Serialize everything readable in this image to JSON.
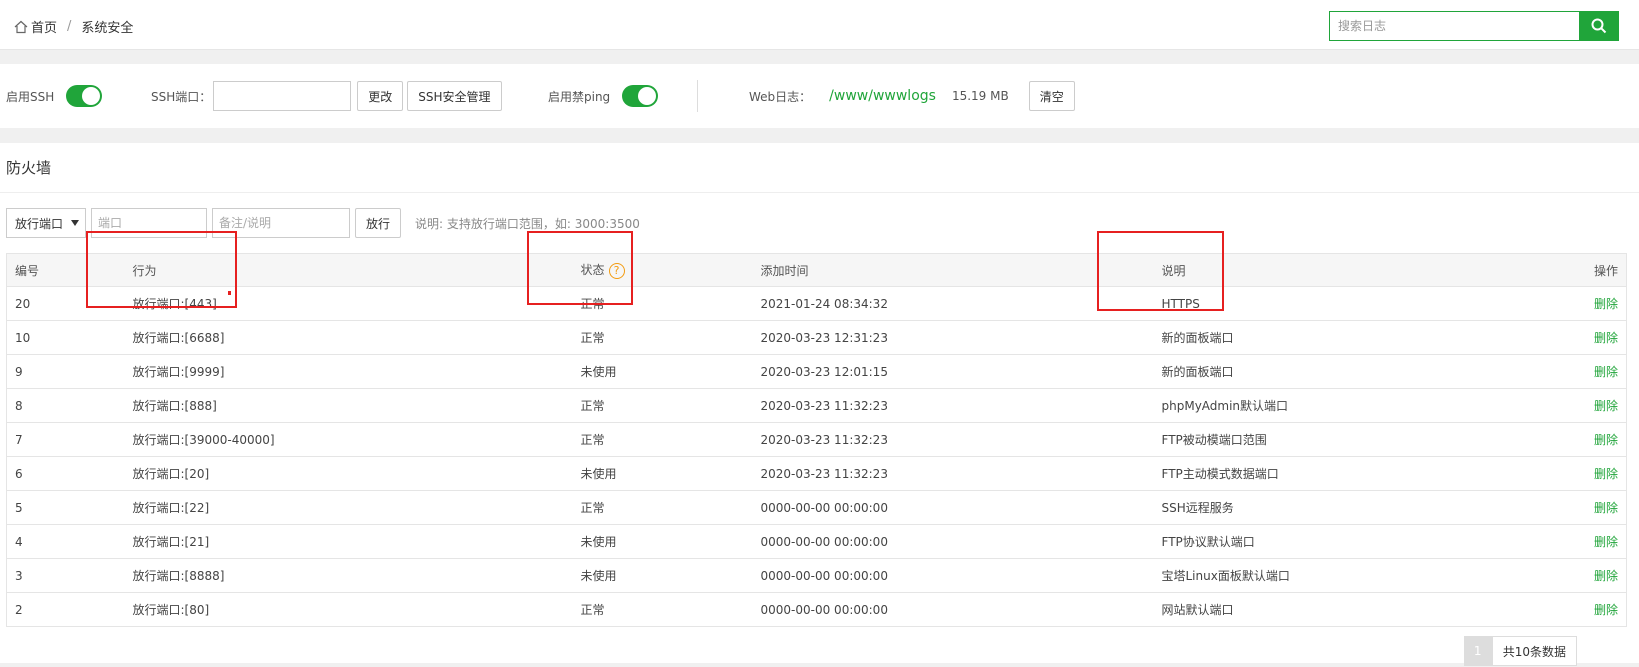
{
  "breadcrumb": {
    "home": "首页",
    "separator": "/",
    "current": "系统安全"
  },
  "search": {
    "placeholder": "搜索日志"
  },
  "settings": {
    "ssh_label": "启用SSH",
    "ssh_enabled": true,
    "ssh_port_label": "SSH端口：",
    "ssh_port_value": "",
    "change_btn": "更改",
    "ssh_manage_btn": "SSH安全管理",
    "ping_label": "启用禁ping",
    "ping_enabled": true,
    "web_log_label": "Web日志：",
    "web_log_path": "/www/wwwlogs",
    "web_log_size": "15.19 MB",
    "clear_btn": "清空"
  },
  "firewall": {
    "title": "防火墙",
    "select_value": "放行端口",
    "port_placeholder": "端口",
    "note_placeholder": "备注/说明",
    "allow_btn": "放行",
    "hint": "说明: 支持放行端口范围，如: 3000:3500",
    "columns": [
      "编号",
      "行为",
      "状态",
      "添加时间",
      "说明",
      "操作"
    ],
    "rows": [
      {
        "id": "20",
        "action": "放行端口:[443]",
        "status": "正常",
        "time": "2021-01-24 08:34:32",
        "desc": "HTTPS",
        "op": "删除"
      },
      {
        "id": "10",
        "action": "放行端口:[6688]",
        "status": "正常",
        "time": "2020-03-23 12:31:23",
        "desc": "新的面板端口",
        "op": "删除"
      },
      {
        "id": "9",
        "action": "放行端口:[9999]",
        "status": "未使用",
        "time": "2020-03-23 12:01:15",
        "desc": "新的面板端口",
        "op": "删除"
      },
      {
        "id": "8",
        "action": "放行端口:[888]",
        "status": "正常",
        "time": "2020-03-23 11:32:23",
        "desc": "phpMyAdmin默认端口",
        "op": "删除"
      },
      {
        "id": "7",
        "action": "放行端口:[39000-40000]",
        "status": "正常",
        "time": "2020-03-23 11:32:23",
        "desc": "FTP被动模端口范围",
        "op": "删除"
      },
      {
        "id": "6",
        "action": "放行端口:[20]",
        "status": "未使用",
        "time": "2020-03-23 11:32:23",
        "desc": "FTP主动模式数据端口",
        "op": "删除"
      },
      {
        "id": "5",
        "action": "放行端口:[22]",
        "status": "正常",
        "time": "0000-00-00 00:00:00",
        "desc": "SSH远程服务",
        "op": "删除"
      },
      {
        "id": "4",
        "action": "放行端口:[21]",
        "status": "未使用",
        "time": "0000-00-00 00:00:00",
        "desc": "FTP协议默认端口",
        "op": "删除"
      },
      {
        "id": "3",
        "action": "放行端口:[8888]",
        "status": "未使用",
        "time": "0000-00-00 00:00:00",
        "desc": "宝塔Linux面板默认端口",
        "op": "删除"
      },
      {
        "id": "2",
        "action": "放行端口:[80]",
        "status": "正常",
        "time": "0000-00-00 00:00:00",
        "desc": "网站默认端口",
        "op": "删除"
      }
    ]
  },
  "pager": {
    "current": "1",
    "total": "共10条数据"
  },
  "colors": {
    "accent": "#20a53a",
    "highlight": "#e62020",
    "warn": "#f39c12"
  }
}
